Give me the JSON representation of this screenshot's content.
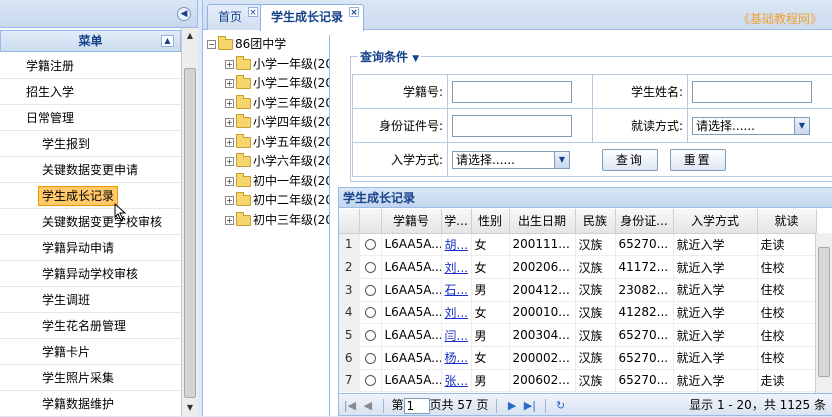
{
  "sidebar": {
    "menu_title": "菜单",
    "items": [
      {
        "label": "学籍注册",
        "level": 0
      },
      {
        "label": "招生入学",
        "level": 0
      },
      {
        "label": "日常管理",
        "level": 0
      },
      {
        "label": "学生报到",
        "level": 1
      },
      {
        "label": "关键数据变更申请",
        "level": 1
      },
      {
        "label": "学生成长记录",
        "level": 1,
        "active": true
      },
      {
        "label": "关键数据变更学校审核",
        "level": 1
      },
      {
        "label": "学籍异动申请",
        "level": 1
      },
      {
        "label": "学籍异动学校审核",
        "level": 1
      },
      {
        "label": "学生调班",
        "level": 1
      },
      {
        "label": "学生花名册管理",
        "level": 1
      },
      {
        "label": "学籍卡片",
        "level": 1
      },
      {
        "label": "学生照片采集",
        "level": 1
      },
      {
        "label": "学籍数据维护",
        "level": 1
      }
    ]
  },
  "tabs": [
    {
      "label": "首页"
    },
    {
      "label": "学生成长记录"
    }
  ],
  "watermark": "《基础教程网》",
  "tree": {
    "root": "86团中学",
    "children": [
      "小学一年级(20",
      "小学二年级(20",
      "小学三年级(20",
      "小学四年级(20",
      "小学五年级(20",
      "小学六年级(20",
      "初中一年级(20",
      "初中二年级(20",
      "初中三年级(20"
    ]
  },
  "query": {
    "title": "查询条件",
    "student_no_label": "学籍号:",
    "student_name_label": "学生姓名:",
    "id_label": "身份证件号:",
    "study_mode_label": "就读方式:",
    "study_mode_value": "请选择......",
    "entry_mode_label": "入学方式:",
    "entry_mode_value": "请选择......",
    "search_btn": "查询",
    "reset_btn": "重置"
  },
  "grid": {
    "title": "学生成长记录",
    "columns": [
      "",
      "",
      "学籍号",
      "学...",
      "性别",
      "出生日期",
      "民族",
      "身份证...",
      "入学方式",
      "就读"
    ],
    "rows": [
      {
        "n": "1",
        "id": "L6AA5A...",
        "name": "胡...",
        "sex": "女",
        "birth": "200111...",
        "eth": "汉族",
        "idno": "65270...",
        "entry": "就近入学",
        "study": "走读"
      },
      {
        "n": "2",
        "id": "L6AA5A...",
        "name": "刘...",
        "sex": "女",
        "birth": "200206...",
        "eth": "汉族",
        "idno": "41172...",
        "entry": "就近入学",
        "study": "住校"
      },
      {
        "n": "3",
        "id": "L6AA5A...",
        "name": "石...",
        "sex": "男",
        "birth": "200412...",
        "eth": "汉族",
        "idno": "23082...",
        "entry": "就近入学",
        "study": "住校"
      },
      {
        "n": "4",
        "id": "L6AA5A...",
        "name": "刘...",
        "sex": "女",
        "birth": "200010...",
        "eth": "汉族",
        "idno": "41282...",
        "entry": "就近入学",
        "study": "住校"
      },
      {
        "n": "5",
        "id": "L6AA5A...",
        "name": "闫...",
        "sex": "男",
        "birth": "200304...",
        "eth": "汉族",
        "idno": "65270...",
        "entry": "就近入学",
        "study": "住校"
      },
      {
        "n": "6",
        "id": "L6AA5A...",
        "name": "杨...",
        "sex": "女",
        "birth": "200002...",
        "eth": "汉族",
        "idno": "65270...",
        "entry": "就近入学",
        "study": "住校"
      },
      {
        "n": "7",
        "id": "L6AA5A...",
        "name": "张...",
        "sex": "男",
        "birth": "200602...",
        "eth": "汉族",
        "idno": "65270...",
        "entry": "就近入学",
        "study": "走读"
      }
    ]
  },
  "pager": {
    "page_prefix": "第",
    "page_value": "1",
    "page_suffix": "页共 57 页",
    "summary": "显示 1 - 20，共 1125 条"
  }
}
